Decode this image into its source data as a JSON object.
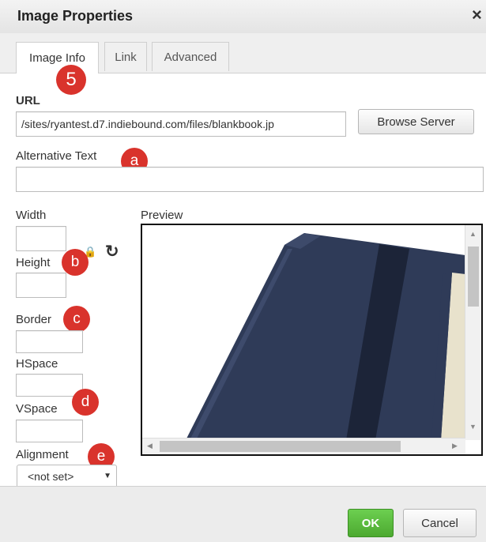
{
  "dialog": {
    "title": "Image Properties",
    "close_glyph": "×",
    "tabs": [
      {
        "label": "Image Info",
        "active": true
      },
      {
        "label": "Link",
        "active": false
      },
      {
        "label": "Advanced",
        "active": false
      }
    ]
  },
  "form": {
    "url_label": "URL",
    "url_value": "/sites/ryantest.d7.indiebound.com/files/blankbook.jp",
    "browse_label": "Browse Server",
    "alt_label": "Alternative Text",
    "alt_value": "",
    "width_label": "Width",
    "width_value": "",
    "height_label": "Height",
    "height_value": "",
    "border_label": "Border",
    "border_value": "",
    "hspace_label": "HSpace",
    "hspace_value": "",
    "vspace_label": "VSpace",
    "vspace_value": "",
    "alignment_label": "Alignment",
    "alignment_value": "<not set>",
    "preview_label": "Preview"
  },
  "annotations": {
    "tab_marker": "5",
    "alt_marker": "a",
    "size_marker": "b",
    "border_marker": "c",
    "spacing_marker": "d",
    "alignment_marker": "e"
  },
  "footer": {
    "ok_label": "OK",
    "cancel_label": "Cancel"
  },
  "icons": {
    "lock": "lock-icon",
    "reset": "reset-size-icon"
  },
  "colors": {
    "ok_green": "#5cb83a",
    "badge_red": "#d9332c",
    "notebook_navy": "#2a3550"
  }
}
